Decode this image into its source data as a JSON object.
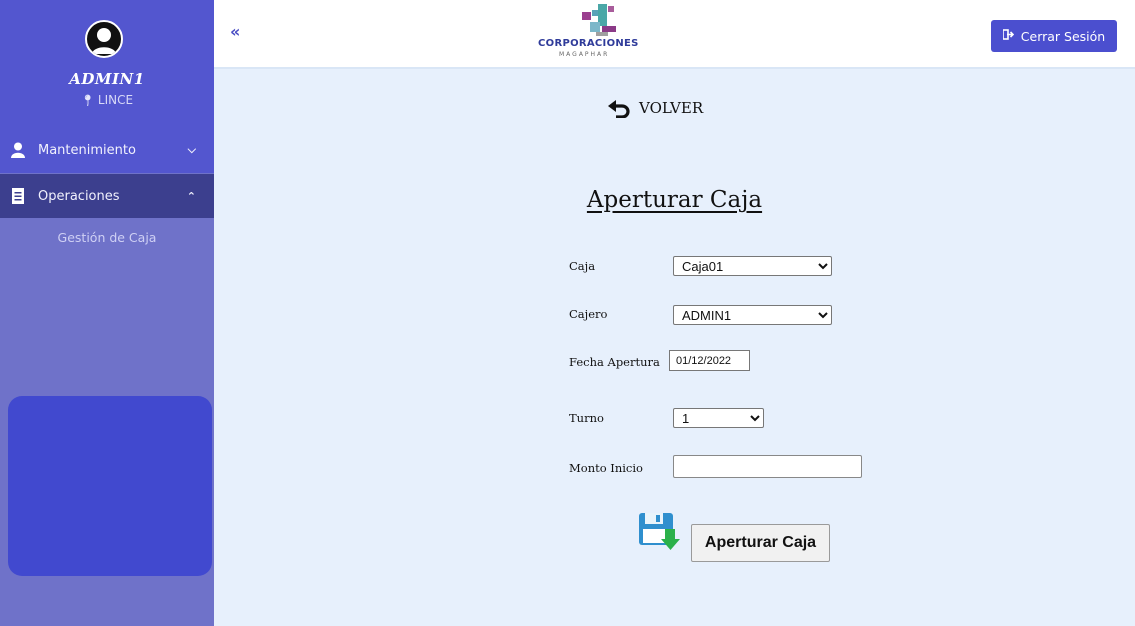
{
  "header": {
    "collapse_label": "«",
    "logo_title": "CORPORACIONES",
    "logo_subtitle": "MAGAPHAR",
    "logout_label": "Cerrar Sesión"
  },
  "sidebar": {
    "user_name": "ADMIN1",
    "location": "LINCE",
    "items": [
      {
        "label": "Mantenimiento",
        "icon": "user-icon",
        "expanded": false
      },
      {
        "label": "Operaciones",
        "icon": "receipt-icon",
        "expanded": true
      }
    ],
    "sub_items": [
      {
        "label": "Gestión de Caja"
      }
    ]
  },
  "main": {
    "back_label": "VOLVER",
    "title": "Aperturar Caja",
    "form": {
      "caja_label": "Caja",
      "caja_value": "Caja01",
      "cajero_label": "Cajero",
      "cajero_value": "ADMIN1",
      "fecha_label": "Fecha Apertura",
      "fecha_value": "01/12/2022",
      "turno_label": "Turno",
      "turno_value": "1",
      "monto_label": "Monto Inicio",
      "monto_value": ""
    },
    "submit_label": "Aperturar Caja"
  },
  "colors": {
    "sidebar_bg": "#6f72c9",
    "sidebar_active": "#3c3f8e",
    "sidebar_top": "#5356cf",
    "accent": "#4b4fcf",
    "main_bg": "#e7f0fc"
  }
}
